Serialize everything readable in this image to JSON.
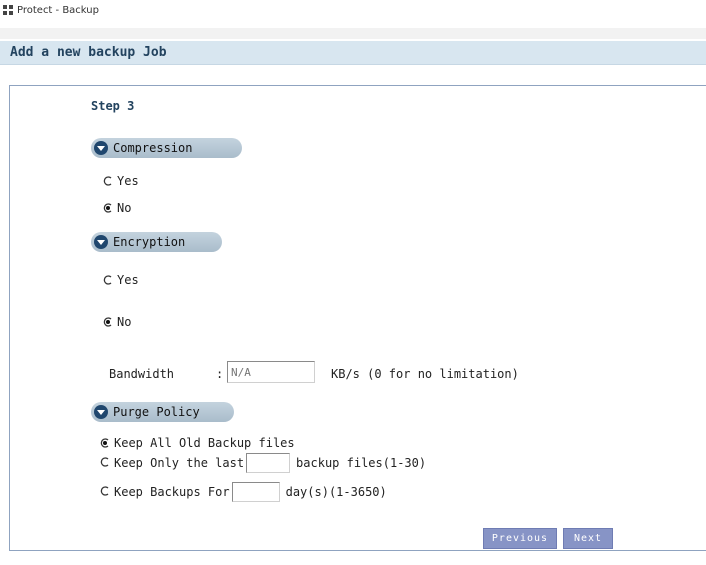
{
  "window": {
    "title": "Protect - Backup"
  },
  "page": {
    "heading": "Add a new backup Job",
    "step": "Step 3"
  },
  "compression": {
    "label": "Compression",
    "options": [
      {
        "label": "Yes",
        "checked": false
      },
      {
        "label": "No",
        "checked": true
      }
    ]
  },
  "encryption": {
    "label": "Encryption",
    "options": [
      {
        "label": "Yes",
        "checked": false
      },
      {
        "label": "No",
        "checked": true
      }
    ]
  },
  "bandwidth": {
    "label": "Bandwidth",
    "separator": ":",
    "value": "",
    "placeholder": "N/A",
    "unit_text": "KB/s (0 for no limitation)"
  },
  "purge": {
    "label": "Purge Policy",
    "keep_all": {
      "label": "Keep All Old Backup files",
      "checked": true
    },
    "keep_last": {
      "prefix": "Keep Only the last",
      "suffix": "backup files(1-30)",
      "value": "",
      "checked": false
    },
    "keep_for": {
      "prefix": "Keep Backups For",
      "suffix": "day(s)(1-3650)",
      "value": "",
      "checked": false
    }
  },
  "buttons": {
    "previous": "Previous",
    "next": "Next"
  },
  "colors": {
    "title_bar": "#d8e6f0",
    "pill": "#b7c8d5",
    "button": "#8794c6",
    "heading_text": "#23435f"
  }
}
